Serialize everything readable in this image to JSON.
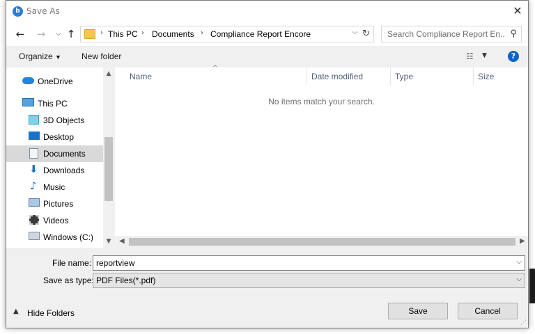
{
  "dialog": {
    "title": "Save As"
  },
  "address": {
    "crumbs": [
      "This PC",
      "Documents",
      "Compliance Report Encore"
    ]
  },
  "search": {
    "placeholder": "Search Compliance Report En..."
  },
  "toolbar": {
    "organize": "Organize",
    "new_folder": "New folder"
  },
  "nav_items": [
    {
      "label": "OneDrive",
      "icon": "onedrive-icon"
    },
    {
      "label": "This PC",
      "icon": "this-pc-icon"
    },
    {
      "label": "3D Objects",
      "icon": "3d-objects-icon"
    },
    {
      "label": "Desktop",
      "icon": "desktop-icon"
    },
    {
      "label": "Documents",
      "icon": "documents-icon",
      "selected": true
    },
    {
      "label": "Downloads",
      "icon": "downloads-icon"
    },
    {
      "label": "Music",
      "icon": "music-icon"
    },
    {
      "label": "Pictures",
      "icon": "pictures-icon"
    },
    {
      "label": "Videos",
      "icon": "videos-icon"
    },
    {
      "label": "Windows (C:)",
      "icon": "drive-icon"
    }
  ],
  "columns": [
    "Name",
    "Date modified",
    "Type",
    "Size"
  ],
  "empty_message": "No items match your search.",
  "form": {
    "file_name_label": "File name:",
    "file_name_value": "reportview",
    "save_type_label": "Save as type:",
    "save_type_value": "PDF Files(*.pdf)"
  },
  "footer": {
    "hide_folders": "Hide Folders",
    "save": "Save",
    "cancel": "Cancel"
  },
  "colors": {
    "accent": "#0a64c8",
    "selection": "#d9d9d9",
    "folder": "#f4c84f"
  }
}
